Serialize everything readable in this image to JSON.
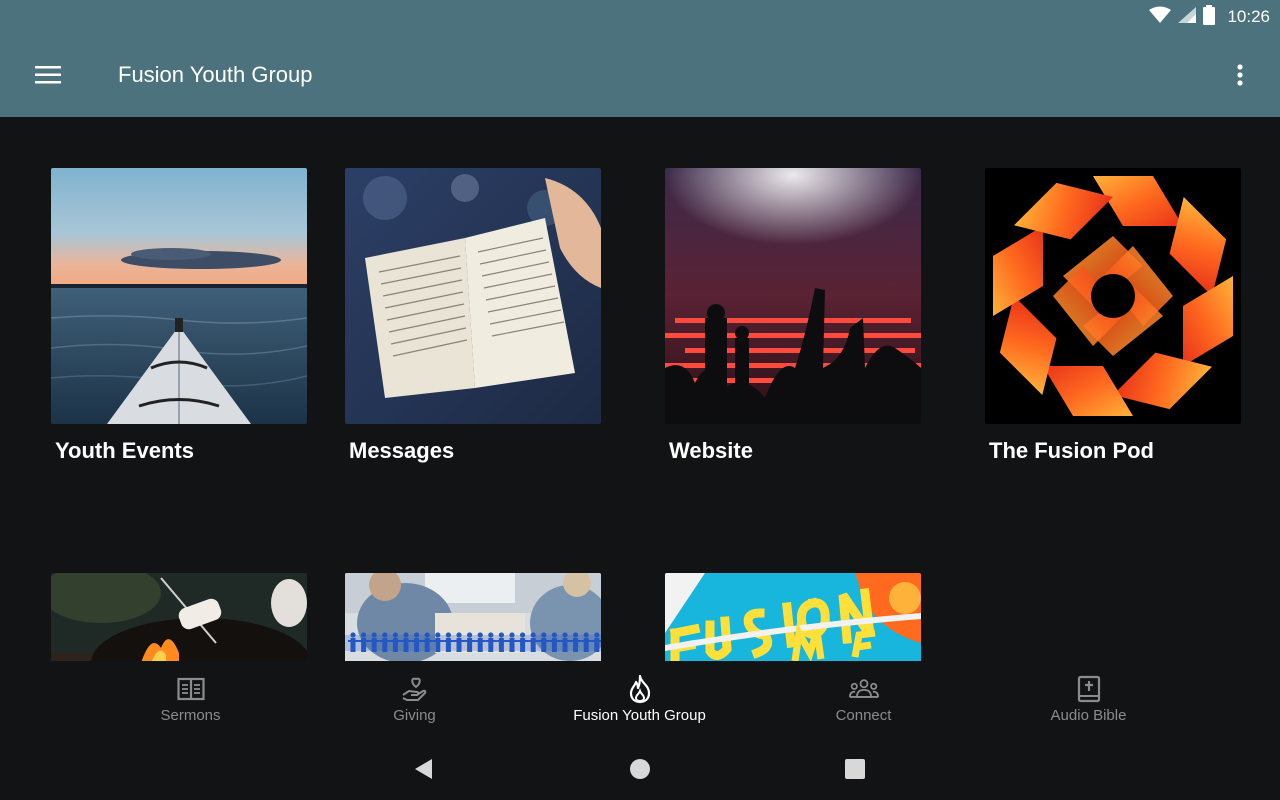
{
  "status_bar": {
    "time": "10:26",
    "icons": [
      "wifi-icon",
      "signal-icon",
      "battery-icon"
    ]
  },
  "app_bar": {
    "title": "Fusion Youth Group",
    "menu_icon": "hamburger-menu-icon",
    "overflow_icon": "more-vertical-icon"
  },
  "colors": {
    "app_bar": "#4b727d",
    "background": "#121314",
    "nav_inactive": "#8a8c8e",
    "nav_active": "#ffffff"
  },
  "tiles": [
    {
      "label": "Youth Events",
      "image": "kayak-lake-sunset-photo"
    },
    {
      "label": "Messages",
      "image": "open-bible-photo"
    },
    {
      "label": "Website",
      "image": "concert-stage-crowd-photo"
    },
    {
      "label": "The Fusion Pod",
      "image": "orange-fusion-logo"
    },
    {
      "label": "",
      "image": "campfire-marshmallow-photo"
    },
    {
      "label": "",
      "image": "group-people-chain-photo"
    },
    {
      "label": "",
      "image": "fusion-summer-graphic"
    }
  ],
  "bottom_nav": [
    {
      "label": "Sermons",
      "icon": "open-book-icon",
      "active": false
    },
    {
      "label": "Giving",
      "icon": "hand-heart-icon",
      "active": false
    },
    {
      "label": "Fusion Youth Group",
      "icon": "flame-icon",
      "active": true
    },
    {
      "label": "Connect",
      "icon": "people-group-icon",
      "active": false
    },
    {
      "label": "Audio Bible",
      "icon": "bible-cross-icon",
      "active": false
    }
  ],
  "system_nav": [
    "back-icon",
    "home-icon",
    "recents-icon"
  ]
}
